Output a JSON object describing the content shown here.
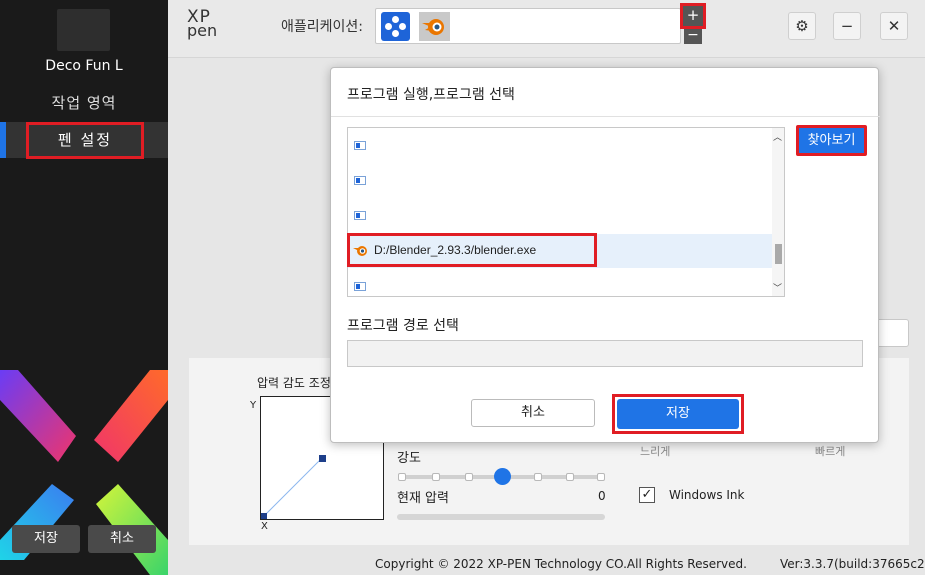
{
  "sidebar": {
    "device_name": "Deco Fun L",
    "nav_work_area": "작업 영역",
    "nav_pen_settings": "펜 설정",
    "save_label": "저장",
    "cancel_label": "취소"
  },
  "header": {
    "logo_top": "XP",
    "logo_bottom": "pen",
    "apps_label": "애플리케이션:",
    "add_label": "+",
    "remove_label": "−",
    "gear_icon": "⚙",
    "minimize_icon": "−",
    "close_icon": "✕"
  },
  "main": {
    "pressure_title": "압력 감도 조정",
    "axis_y": "Y",
    "axis_x": "X",
    "strength_label": "강도",
    "current_pressure_label": "현재 압력",
    "current_pressure_value": "0",
    "slow_label": "느리게",
    "fast_label": "빠르게",
    "windows_ink_label": "Windows Ink",
    "windows_ink_check": "✓"
  },
  "footer": {
    "copyright": "Copyright © 2022  XP-PEN Technology CO.All Rights Reserved.",
    "version": "Ver:3.3.7(build:37665c2)"
  },
  "dialog": {
    "title": "프로그램 실행,프로그램 선택",
    "list_items": [
      "",
      "",
      "",
      "D:/Blender_2.93.3/blender.exe",
      ""
    ],
    "browse_label": "찾아보기",
    "path_label": "프로그램 경로 선택",
    "path_value": "",
    "cancel_label": "취소",
    "save_label": "저장"
  },
  "colors": {
    "accent": "#1f74e6",
    "highlight": "#e01d24",
    "sidebar_bg": "#1a1a1a"
  }
}
